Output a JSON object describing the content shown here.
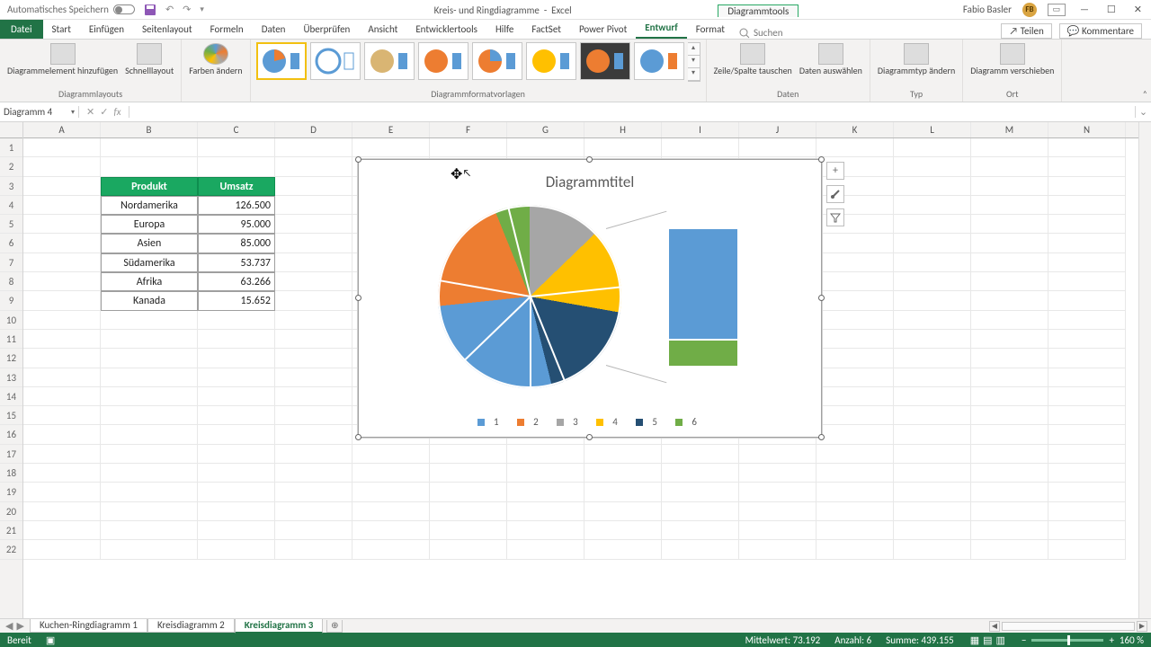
{
  "titlebar": {
    "autosave": "Automatisches Speichern",
    "doc": "Kreis- und Ringdiagramme",
    "app": "Excel",
    "tooltab": "Diagrammtools",
    "user": "Fabio Basler",
    "user_initials": "FB"
  },
  "tabs": {
    "file": "Datei",
    "list": [
      "Start",
      "Einfügen",
      "Seitenlayout",
      "Formeln",
      "Daten",
      "Überprüfen",
      "Ansicht",
      "Entwicklertools",
      "Hilfe",
      "FactSet",
      "Power Pivot",
      "Entwurf",
      "Format"
    ],
    "active": "Entwurf",
    "search_placeholder": "Suchen",
    "share": "Teilen",
    "comments": "Kommentare"
  },
  "ribbon": {
    "g1a": "Diagrammelement hinzufügen",
    "g1b": "Schnelllayout",
    "g1_label": "Diagrammlayouts",
    "g2": "Farben ändern",
    "g3_label": "Diagrammformatvorlagen",
    "g4a": "Zeile/Spalte tauschen",
    "g4b": "Daten auswählen",
    "g4_label": "Daten",
    "g5": "Diagrammtyp ändern",
    "g5_label": "Typ",
    "g6": "Diagramm verschieben",
    "g6_label": "Ort"
  },
  "fx": {
    "namebox": "Diagramm 4",
    "fx": "fx"
  },
  "columns": [
    "A",
    "B",
    "C",
    "D",
    "E",
    "F",
    "G",
    "H",
    "I",
    "J",
    "K",
    "L",
    "M",
    "N"
  ],
  "rows": 22,
  "table": {
    "header": [
      "Produkt",
      "Umsatz"
    ],
    "rows": [
      [
        "Nordamerika",
        "126.500"
      ],
      [
        "Europa",
        "95.000"
      ],
      [
        "Asien",
        "85.000"
      ],
      [
        "Südamerika",
        "53.737"
      ],
      [
        "Afrika",
        "63.266"
      ],
      [
        "Kanada",
        "15.652"
      ]
    ]
  },
  "chart_data": {
    "type": "pie",
    "subtype": "bar-of-pie",
    "title": "Diagrammtitel",
    "categories": [
      "Nordamerika",
      "Europa",
      "Asien",
      "Südamerika",
      "Afrika",
      "Kanada"
    ],
    "values": [
      126500,
      95000,
      85000,
      53737,
      63266,
      15652
    ],
    "legend_labels": [
      "1",
      "2",
      "3",
      "4",
      "5",
      "6"
    ],
    "colors": {
      "1": "#5b9bd5",
      "2": "#ed7d31",
      "3": "#a6a6a6",
      "4": "#ffc000",
      "5": "#254f73",
      "6": "#70ad47"
    },
    "secondary_plot_series": [
      5,
      6
    ]
  },
  "sheets": {
    "list": [
      "Kuchen-Ringdiagramm 1",
      "Kreisdiagramm 2",
      "Kreisdiagramm 3"
    ],
    "active": "Kreisdiagramm 3"
  },
  "status": {
    "ready": "Bereit",
    "mean_label": "Mittelwert:",
    "mean": "73.192",
    "count_label": "Anzahl:",
    "count": "6",
    "sum_label": "Summe:",
    "sum": "439.155",
    "zoom": "160 %"
  }
}
